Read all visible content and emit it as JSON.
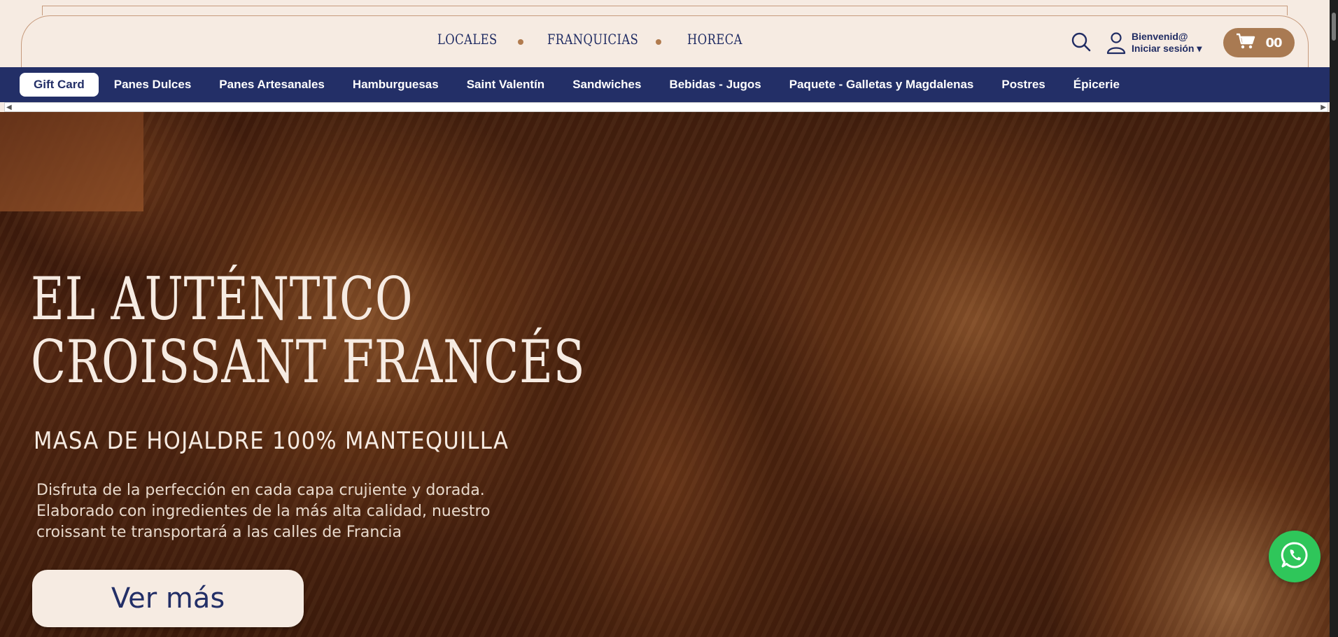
{
  "topnav": {
    "items": [
      "LOCALES",
      "FRANQUICIAS",
      "HORECA"
    ]
  },
  "account": {
    "greeting": "Bienvenid@",
    "login": "Iniciar sesión ▾"
  },
  "cart": {
    "count": "00"
  },
  "categories": [
    "Gift Card",
    "Panes Dulces",
    "Panes Artesanales",
    "Hamburguesas",
    "Saint Valentín",
    "Sandwiches",
    "Bebidas - Jugos",
    "Paquete - Galletas y Magdalenas",
    "Postres",
    "Épicerie"
  ],
  "hero": {
    "title_line1": "EL AUTÉNTICO",
    "title_line2": "CROISSANT FRANCÉS",
    "subtitle": "MASA DE HOJALDRE 100% MANTEQUILLA",
    "desc_line1": "Disfruta de la perfección en cada capa crujiente y dorada.",
    "desc_line2": "Elaborado con ingredientes de la más alta calidad, nuestro",
    "desc_line3": "croissant te transportará a las calles de Francia",
    "cta": "Ver más"
  },
  "scroll": {
    "left": "◀",
    "right": "▶"
  },
  "colors": {
    "navy": "#232f67",
    "cream": "#f6ebe2",
    "copper": "#a97a52",
    "whatsapp": "#2fc65a"
  },
  "icons": [
    "search-icon",
    "user-icon",
    "cart-icon",
    "whatsapp-icon"
  ]
}
